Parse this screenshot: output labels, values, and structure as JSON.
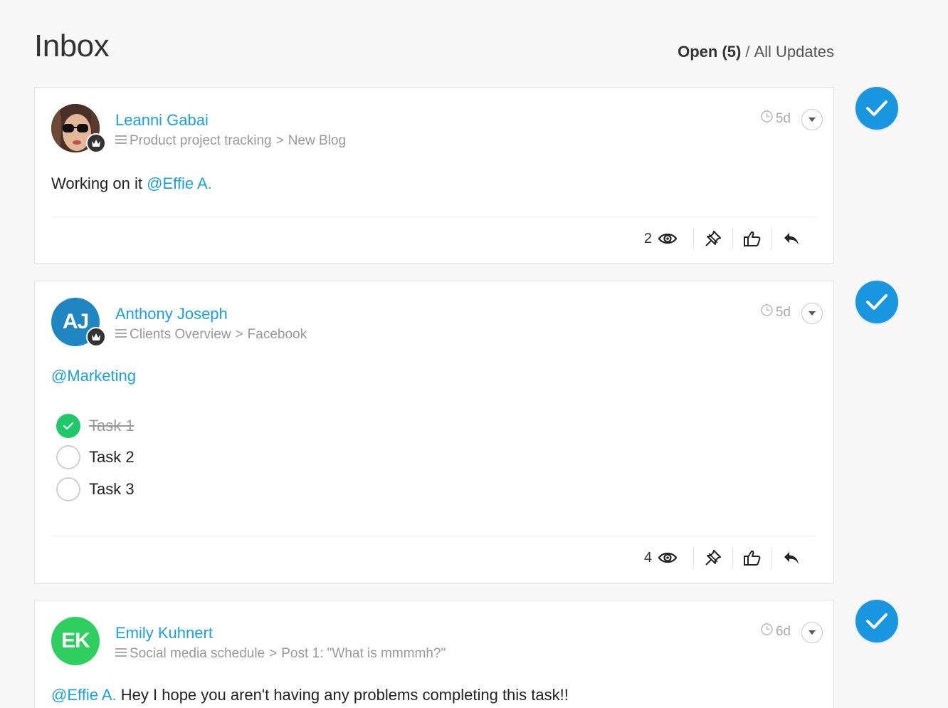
{
  "header": {
    "title": "Inbox",
    "filter_open": "Open (5)",
    "filter_sep": "/",
    "filter_all": "All Updates"
  },
  "colors": {
    "accent": "#1aa1e0",
    "side_check": "#1996e0",
    "task_done": "#20c86a",
    "avatar_aj": "#1f86c2",
    "avatar_ek": "#2fcf5f"
  },
  "posts": [
    {
      "author": "Leanni Gabai",
      "avatar_initials": "",
      "board": "Product project tracking",
      "item": "New Blog",
      "time": "5d",
      "text_prefix": "Working on it ",
      "mention": "@Effie A.",
      "views": "2"
    },
    {
      "author": "Anthony Joseph",
      "avatar_initials": "AJ",
      "board": "Clients Overview",
      "item": "Facebook",
      "time": "5d",
      "mention": "@Marketing",
      "tasks": [
        {
          "label": "Task 1",
          "done": true
        },
        {
          "label": "Task 2",
          "done": false
        },
        {
          "label": "Task 3",
          "done": false
        }
      ],
      "views": "4"
    },
    {
      "author": "Emily Kuhnert",
      "avatar_initials": "EK",
      "board": "Social media schedule",
      "item": "Post 1: \"What is mmmmh?\"",
      "time": "6d",
      "mention": "@Effie A.",
      "text_suffix": " Hey I hope you aren't having any problems completing this task!!"
    }
  ],
  "icons": {
    "path": "list-icon",
    "time": "clock-icon",
    "menu": "chevron-down-icon",
    "views": "eye-icon",
    "pin": "pin-icon",
    "like": "thumbs-up-icon",
    "reply": "reply-icon",
    "done": "checkmark-icon",
    "crown": "crown-icon"
  },
  "separator": ">"
}
